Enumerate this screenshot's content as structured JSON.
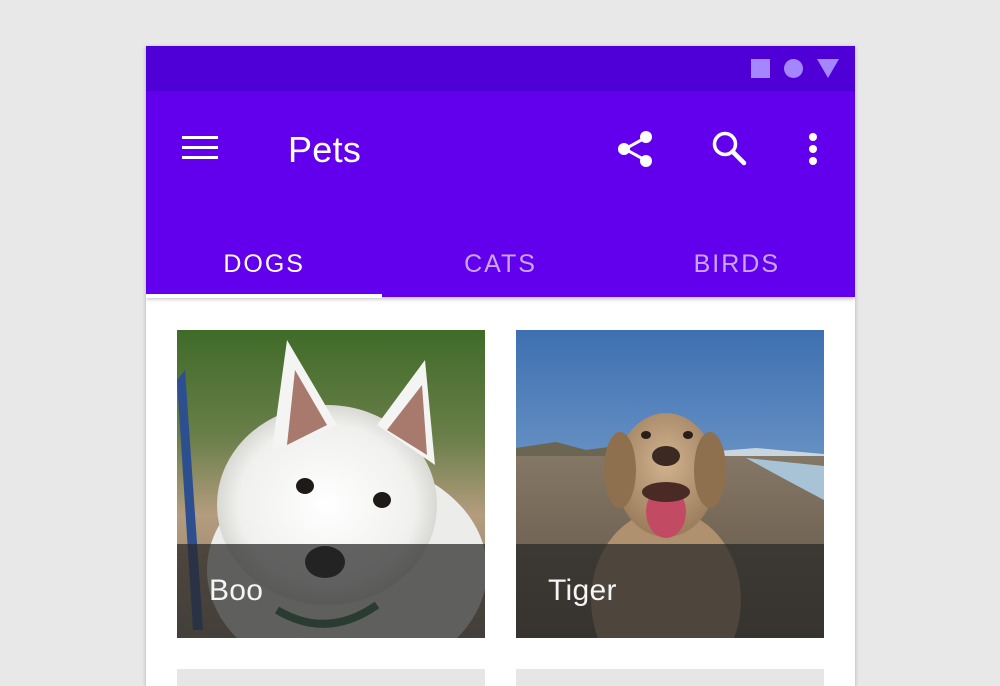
{
  "app": {
    "title": "Pets",
    "actions": [
      "share-icon",
      "search-icon",
      "more-vert-icon"
    ],
    "navigation_icon": "menu-icon",
    "colors": {
      "primary": "#6200ee",
      "primary_dark": "#4f00d6",
      "on_primary": "#ffffff"
    }
  },
  "status_bar": {
    "icons": [
      "square-icon",
      "circle-icon",
      "triangle-icon"
    ]
  },
  "tabs": [
    {
      "label": "DOGS",
      "selected": true
    },
    {
      "label": "CATS",
      "selected": false
    },
    {
      "label": "BIRDS",
      "selected": false
    }
  ],
  "cards": [
    {
      "name": "Boo"
    },
    {
      "name": "Tiger"
    }
  ]
}
